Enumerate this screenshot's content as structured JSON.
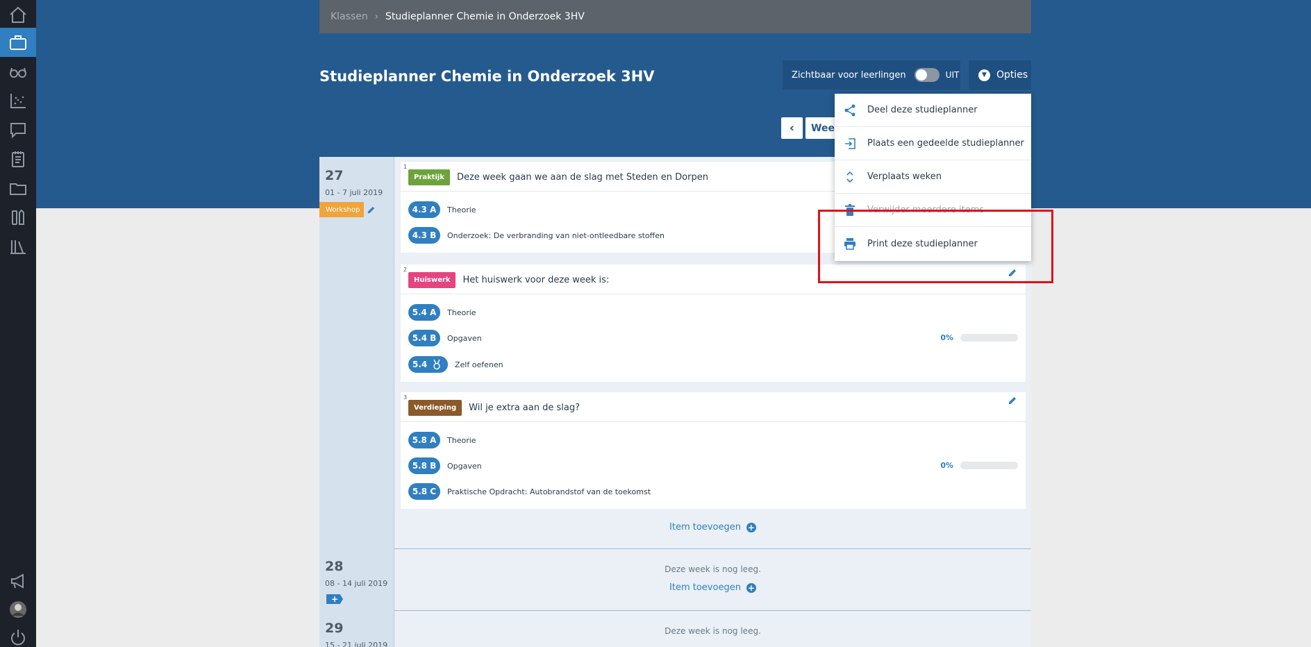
{
  "sidebar": {
    "items": [
      {
        "icon": "home-icon"
      },
      {
        "icon": "briefcase-icon",
        "active": true
      },
      {
        "icon": "glasses-icon"
      },
      {
        "icon": "scatter-chart-icon"
      },
      {
        "icon": "chat-icon"
      },
      {
        "icon": "notepad-icon"
      },
      {
        "icon": "folder-icon"
      },
      {
        "icon": "tools-icon"
      },
      {
        "icon": "library-icon"
      },
      {
        "icon": "megaphone-icon"
      },
      {
        "icon": "avatar-icon"
      },
      {
        "icon": "power-icon"
      }
    ]
  },
  "breadcrumb": {
    "parent": "Klassen",
    "current": "Studieplanner Chemie in Onderzoek 3HV"
  },
  "header": {
    "title": "Studieplanner Chemie in Onderzoek 3HV",
    "visibility_label": "Zichtbaar voor leerlingen",
    "toggle_state": "UIT",
    "options_label": "Opties"
  },
  "week_nav": {
    "prev_icon": "chevron-left-icon",
    "week_label": "Week"
  },
  "options_menu": {
    "items": [
      {
        "label": "Deel deze studieplanner",
        "icon": "share-icon"
      },
      {
        "label": "Plaats een gedeelde studieplanner",
        "icon": "import-icon"
      },
      {
        "label": "Verplaats weken",
        "icon": "move-vertical-icon"
      },
      {
        "label": "Verwijder meerdere items",
        "icon": "trash-icon"
      },
      {
        "label": "Print deze studieplanner",
        "icon": "print-icon"
      }
    ]
  },
  "colors": {
    "praktijk": "#6da33c",
    "huiswerk": "#e4457f",
    "verdieping": "#8b5a2b",
    "workshop": "#f0a43a",
    "accent": "#2f7fc1",
    "header": "#255a8e"
  },
  "weeks": [
    {
      "number": "27",
      "dates": "01 - 7 juli 2019",
      "tag": "Workshop",
      "items": [
        {
          "num": "1",
          "tag": "Praktijk",
          "title": "Deze week gaan we aan de slag met Steden en Dorpen",
          "sections": [
            {
              "code": "4.3 A",
              "label": "Theorie"
            },
            {
              "code": "4.3 B",
              "label": "Onderzoek: De verbranding van niet-ontleedbare stoffen"
            }
          ]
        },
        {
          "num": "2",
          "tag": "Huiswerk",
          "title": "Het huiswerk voor deze week is:",
          "sections": [
            {
              "code": "5.4 A",
              "label": "Theorie"
            },
            {
              "code": "5.4 B",
              "label": "Opgaven",
              "progress": "0%"
            },
            {
              "code": "5.4",
              "label": "Zelf oefenen"
            }
          ]
        },
        {
          "num": "3",
          "tag": "Verdieping",
          "title": "Wil je extra aan de slag?",
          "sections": [
            {
              "code": "5.8 A",
              "label": "Theorie"
            },
            {
              "code": "5.8 B",
              "label": "Opgaven",
              "progress": "0%"
            },
            {
              "code": "5.8 C",
              "label": "Praktische Opdracht: Autobrandstof van de toekomst"
            }
          ]
        }
      ],
      "add_item": "Item toevoegen"
    },
    {
      "number": "28",
      "dates": "08 - 14 juli 2019",
      "add_tag": "+",
      "empty": "Deze week is nog leeg.",
      "add_item": "Item toevoegen"
    },
    {
      "number": "29",
      "dates": "15 - 21 juli 2019",
      "empty": "Deze week is nog leeg."
    }
  ]
}
